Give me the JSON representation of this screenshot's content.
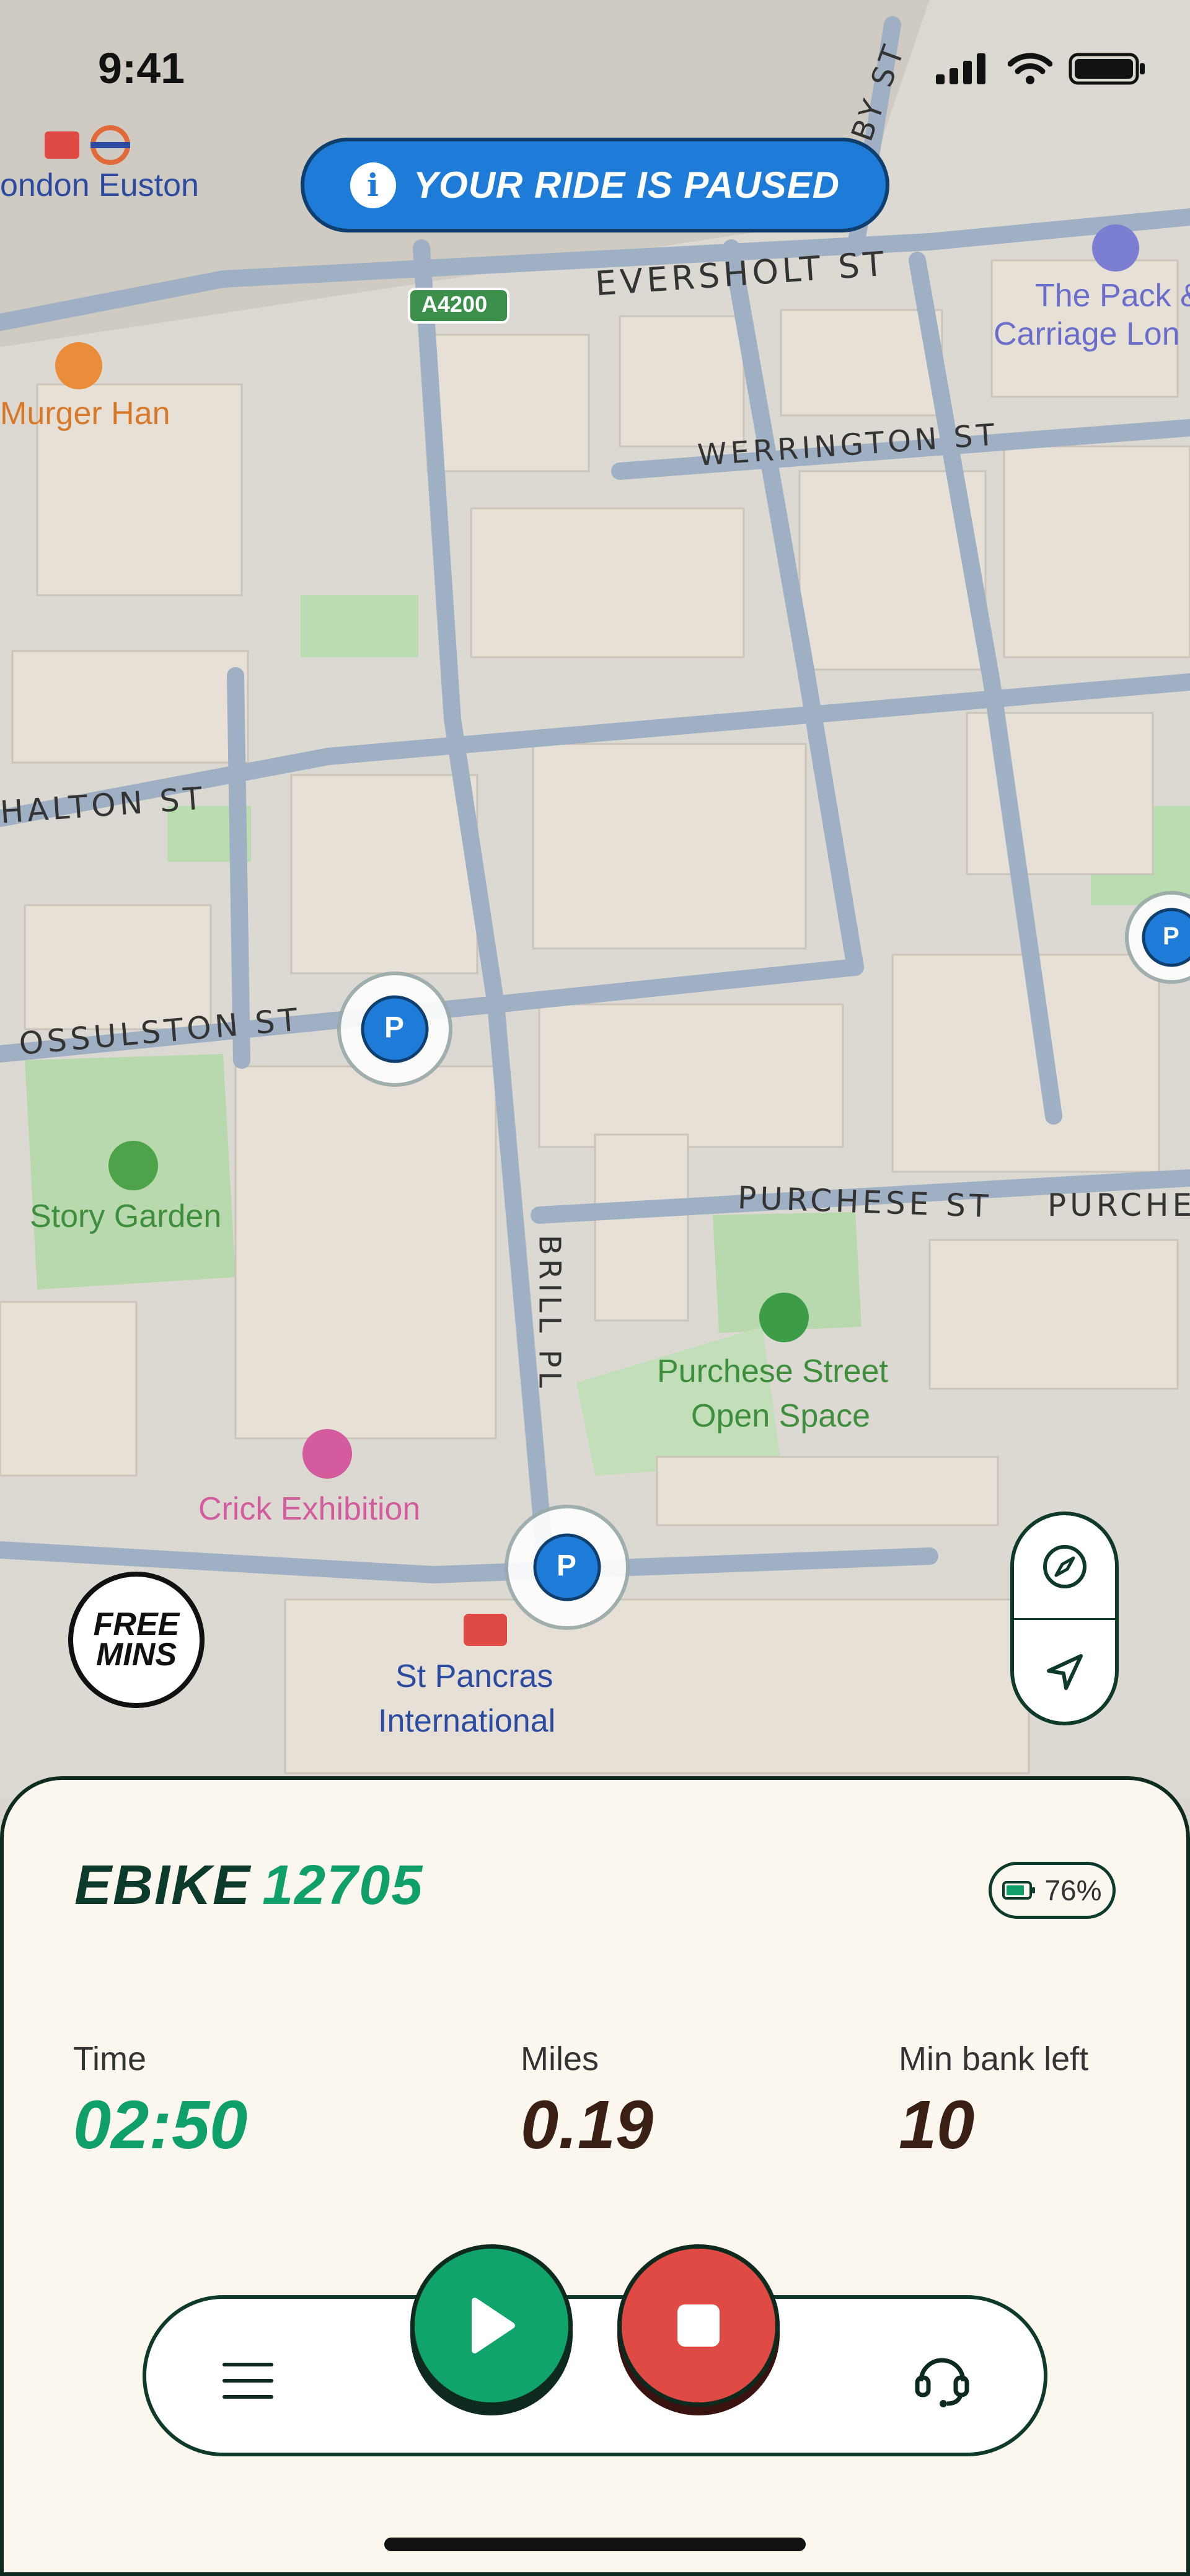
{
  "status_bar": {
    "time": "9:41"
  },
  "banner": {
    "text": "YOUR RIDE IS PAUSED",
    "color": "#1f7bd8"
  },
  "map": {
    "pois": {
      "london_euston": "ondon Euston",
      "murger_han": "Murger Han",
      "the_pack_line1": "The Pack &",
      "the_pack_line2": "Carriage Lon",
      "story_garden": "Story Garden",
      "purchese_line1": "Purchese Street",
      "purchese_line2": "Open Space",
      "crick": "Crick Exhibition",
      "st_pancras_line1": "St Pancras",
      "st_pancras_line2": "International"
    },
    "streets": {
      "eversholt": "EVERSHOLT ST",
      "werrington": "WERRINGTON ST",
      "chalton": "HALTON ST",
      "ossulston": "OSSULSTON ST",
      "purchese": "PURCHESE ST",
      "purchese2": "PURCHES",
      "brill": "BRILL PL",
      "aby": "BY ST"
    },
    "road_shield": "A4200",
    "parking_marker": "P",
    "colors": {
      "accent_green": "#0fa06a",
      "park": "#b9dcb0",
      "road": "#9fb0c4"
    }
  },
  "free_mins": {
    "line1": "FREE",
    "line2": "MINS"
  },
  "ride_panel": {
    "vehicle_type": "EBIKE",
    "vehicle_number": "12705",
    "battery": "76%",
    "stats": [
      {
        "label": "Time",
        "value": "02:50",
        "color": "#0fa06a"
      },
      {
        "label": "Miles",
        "value": "0.19",
        "color": "#3a1f15"
      },
      {
        "label": "Min bank left",
        "value": "10",
        "color": "#3a1f15"
      }
    ],
    "controls": {
      "menu_icon": "hamburger-menu-icon",
      "play_icon": "play-icon",
      "stop_icon": "stop-icon",
      "support_icon": "headset-icon",
      "play_color": "#10a36a",
      "stop_color": "#e04a45"
    }
  }
}
